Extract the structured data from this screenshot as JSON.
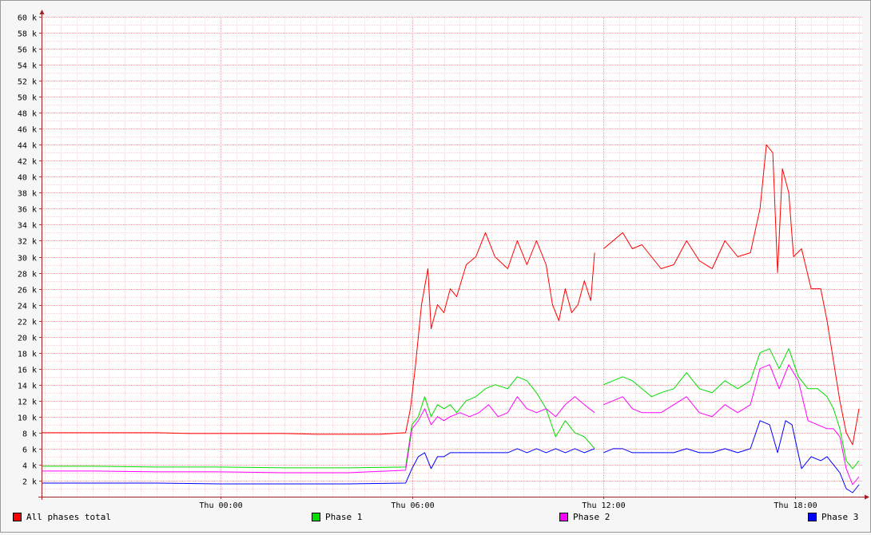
{
  "chart_data": {
    "type": "line",
    "ylim": [
      0,
      60000
    ],
    "y_ticks": [
      {
        "value": 2000,
        "label": "2 k"
      },
      {
        "value": 4000,
        "label": "4 k"
      },
      {
        "value": 6000,
        "label": "6 k"
      },
      {
        "value": 8000,
        "label": "8 k"
      },
      {
        "value": 10000,
        "label": "10 k"
      },
      {
        "value": 12000,
        "label": "12 k"
      },
      {
        "value": 14000,
        "label": "14 k"
      },
      {
        "value": 16000,
        "label": "16 k"
      },
      {
        "value": 18000,
        "label": "18 k"
      },
      {
        "value": 20000,
        "label": "20 k"
      },
      {
        "value": 22000,
        "label": "22 k"
      },
      {
        "value": 24000,
        "label": "24 k"
      },
      {
        "value": 26000,
        "label": "26 k"
      },
      {
        "value": 28000,
        "label": "28 k"
      },
      {
        "value": 30000,
        "label": "30 k"
      },
      {
        "value": 32000,
        "label": "32 k"
      },
      {
        "value": 34000,
        "label": "34 k"
      },
      {
        "value": 36000,
        "label": "36 k"
      },
      {
        "value": 38000,
        "label": "38 k"
      },
      {
        "value": 40000,
        "label": "40 k"
      },
      {
        "value": 42000,
        "label": "42 k"
      },
      {
        "value": 44000,
        "label": "44 k"
      },
      {
        "value": 46000,
        "label": "46 k"
      },
      {
        "value": 48000,
        "label": "48 k"
      },
      {
        "value": 50000,
        "label": "50 k"
      },
      {
        "value": 52000,
        "label": "52 k"
      },
      {
        "value": 54000,
        "label": "54 k"
      },
      {
        "value": 56000,
        "label": "56 k"
      },
      {
        "value": 58000,
        "label": "58 k"
      },
      {
        "value": 60000,
        "label": "60 k"
      }
    ],
    "xlim": [
      -5.6,
      20.1
    ],
    "x_unit": "hours relative to Thu 00:00",
    "x_ticks": [
      {
        "value": 0,
        "label": "Thu 00:00"
      },
      {
        "value": 6,
        "label": "Thu 06:00"
      },
      {
        "value": 12,
        "label": "Thu 12:00"
      },
      {
        "value": 18,
        "label": "Thu 18:00"
      }
    ],
    "grid": true,
    "legend_position": "bottom",
    "series": [
      {
        "name": "All phases total",
        "color": "#ff0000",
        "points": [
          [
            -5.6,
            8000
          ],
          [
            -5.0,
            8000
          ],
          [
            -4.0,
            8000
          ],
          [
            -3.0,
            8000
          ],
          [
            -2.0,
            8000
          ],
          [
            -1.0,
            7900
          ],
          [
            0.0,
            7900
          ],
          [
            1.0,
            7900
          ],
          [
            2.0,
            7900
          ],
          [
            3.0,
            7800
          ],
          [
            4.0,
            7800
          ],
          [
            5.0,
            7800
          ],
          [
            5.8,
            8000
          ],
          [
            5.95,
            11000
          ],
          [
            6.1,
            16000
          ],
          [
            6.3,
            24000
          ],
          [
            6.5,
            28500
          ],
          [
            6.6,
            21000
          ],
          [
            6.8,
            24000
          ],
          [
            7.0,
            23000
          ],
          [
            7.2,
            26000
          ],
          [
            7.4,
            25000
          ],
          [
            7.7,
            29000
          ],
          [
            8.0,
            30000
          ],
          [
            8.3,
            33000
          ],
          [
            8.6,
            30000
          ],
          [
            9.0,
            28500
          ],
          [
            9.3,
            32000
          ],
          [
            9.6,
            29000
          ],
          [
            9.9,
            32000
          ],
          [
            10.2,
            29000
          ],
          [
            10.4,
            24000
          ],
          [
            10.6,
            22000
          ],
          [
            10.8,
            26000
          ],
          [
            11.0,
            23000
          ],
          [
            11.2,
            24000
          ],
          [
            11.4,
            27000
          ],
          [
            11.6,
            24500
          ],
          [
            11.72,
            30500
          ],
          [
            11.73,
            null
          ],
          [
            12.0,
            31000
          ],
          [
            12.3,
            32000
          ],
          [
            12.6,
            33000
          ],
          [
            12.9,
            31000
          ],
          [
            13.2,
            31500
          ],
          [
            13.5,
            30000
          ],
          [
            13.8,
            28500
          ],
          [
            14.2,
            29000
          ],
          [
            14.6,
            32000
          ],
          [
            15.0,
            29500
          ],
          [
            15.4,
            28500
          ],
          [
            15.8,
            32000
          ],
          [
            16.2,
            30000
          ],
          [
            16.6,
            30500
          ],
          [
            16.9,
            36000
          ],
          [
            17.1,
            44000
          ],
          [
            17.3,
            43000
          ],
          [
            17.45,
            28000
          ],
          [
            17.6,
            41000
          ],
          [
            17.8,
            38000
          ],
          [
            17.95,
            30000
          ],
          [
            18.2,
            31000
          ],
          [
            18.5,
            26000
          ],
          [
            18.8,
            26000
          ],
          [
            19.0,
            22000
          ],
          [
            19.2,
            17000
          ],
          [
            19.4,
            12000
          ],
          [
            19.6,
            8000
          ],
          [
            19.8,
            6500
          ],
          [
            20.0,
            11000
          ]
        ]
      },
      {
        "name": "Phase 1",
        "color": "#00dd00",
        "points": [
          [
            -5.6,
            3800
          ],
          [
            -4.0,
            3800
          ],
          [
            -2.0,
            3700
          ],
          [
            0.0,
            3700
          ],
          [
            2.0,
            3600
          ],
          [
            4.0,
            3600
          ],
          [
            5.8,
            3700
          ],
          [
            6.0,
            9000
          ],
          [
            6.2,
            10000
          ],
          [
            6.4,
            12500
          ],
          [
            6.6,
            10000
          ],
          [
            6.8,
            11500
          ],
          [
            7.0,
            11000
          ],
          [
            7.2,
            11500
          ],
          [
            7.4,
            10500
          ],
          [
            7.7,
            12000
          ],
          [
            8.0,
            12500
          ],
          [
            8.3,
            13500
          ],
          [
            8.6,
            14000
          ],
          [
            9.0,
            13500
          ],
          [
            9.3,
            15000
          ],
          [
            9.6,
            14500
          ],
          [
            9.9,
            13000
          ],
          [
            10.2,
            11000
          ],
          [
            10.5,
            7500
          ],
          [
            10.8,
            9500
          ],
          [
            11.1,
            8000
          ],
          [
            11.4,
            7500
          ],
          [
            11.72,
            6000
          ],
          [
            11.73,
            null
          ],
          [
            12.0,
            14000
          ],
          [
            12.3,
            14500
          ],
          [
            12.6,
            15000
          ],
          [
            12.9,
            14500
          ],
          [
            13.2,
            13500
          ],
          [
            13.5,
            12500
          ],
          [
            13.8,
            13000
          ],
          [
            14.2,
            13500
          ],
          [
            14.6,
            15500
          ],
          [
            15.0,
            13500
          ],
          [
            15.4,
            13000
          ],
          [
            15.8,
            14500
          ],
          [
            16.2,
            13500
          ],
          [
            16.6,
            14500
          ],
          [
            16.9,
            18000
          ],
          [
            17.2,
            18500
          ],
          [
            17.5,
            16000
          ],
          [
            17.8,
            18500
          ],
          [
            18.1,
            15000
          ],
          [
            18.4,
            13500
          ],
          [
            18.7,
            13500
          ],
          [
            19.0,
            12500
          ],
          [
            19.2,
            11000
          ],
          [
            19.4,
            8500
          ],
          [
            19.6,
            4500
          ],
          [
            19.8,
            3500
          ],
          [
            20.0,
            4500
          ]
        ]
      },
      {
        "name": "Phase 2",
        "color": "#ff00ff",
        "points": [
          [
            -5.6,
            3200
          ],
          [
            -4.0,
            3200
          ],
          [
            -2.0,
            3100
          ],
          [
            0.0,
            3100
          ],
          [
            2.0,
            3000
          ],
          [
            4.0,
            3000
          ],
          [
            5.8,
            3300
          ],
          [
            6.0,
            8500
          ],
          [
            6.2,
            9500
          ],
          [
            6.4,
            11000
          ],
          [
            6.6,
            9000
          ],
          [
            6.8,
            10000
          ],
          [
            7.0,
            9500
          ],
          [
            7.2,
            10000
          ],
          [
            7.5,
            10500
          ],
          [
            7.8,
            10000
          ],
          [
            8.1,
            10500
          ],
          [
            8.4,
            11500
          ],
          [
            8.7,
            10000
          ],
          [
            9.0,
            10500
          ],
          [
            9.3,
            12500
          ],
          [
            9.6,
            11000
          ],
          [
            9.9,
            10500
          ],
          [
            10.2,
            11000
          ],
          [
            10.5,
            10000
          ],
          [
            10.8,
            11500
          ],
          [
            11.1,
            12500
          ],
          [
            11.4,
            11500
          ],
          [
            11.72,
            10500
          ],
          [
            11.73,
            null
          ],
          [
            12.0,
            11500
          ],
          [
            12.3,
            12000
          ],
          [
            12.6,
            12500
          ],
          [
            12.9,
            11000
          ],
          [
            13.2,
            10500
          ],
          [
            13.5,
            10500
          ],
          [
            13.8,
            10500
          ],
          [
            14.2,
            11500
          ],
          [
            14.6,
            12500
          ],
          [
            15.0,
            10500
          ],
          [
            15.4,
            10000
          ],
          [
            15.8,
            11500
          ],
          [
            16.2,
            10500
          ],
          [
            16.6,
            11500
          ],
          [
            16.9,
            16000
          ],
          [
            17.2,
            16500
          ],
          [
            17.5,
            13500
          ],
          [
            17.8,
            16500
          ],
          [
            18.1,
            14500
          ],
          [
            18.4,
            9500
          ],
          [
            18.7,
            9000
          ],
          [
            19.0,
            8500
          ],
          [
            19.2,
            8500
          ],
          [
            19.4,
            7500
          ],
          [
            19.6,
            3500
          ],
          [
            19.8,
            1500
          ],
          [
            20.0,
            2500
          ]
        ]
      },
      {
        "name": "Phase 3",
        "color": "#0000ff",
        "points": [
          [
            -5.6,
            1700
          ],
          [
            -4.0,
            1700
          ],
          [
            -2.0,
            1700
          ],
          [
            0.0,
            1600
          ],
          [
            2.0,
            1600
          ],
          [
            4.0,
            1600
          ],
          [
            5.8,
            1700
          ],
          [
            6.0,
            3500
          ],
          [
            6.2,
            5000
          ],
          [
            6.4,
            5500
          ],
          [
            6.6,
            3500
          ],
          [
            6.8,
            5000
          ],
          [
            7.0,
            5000
          ],
          [
            7.2,
            5500
          ],
          [
            7.5,
            5500
          ],
          [
            7.8,
            5500
          ],
          [
            8.1,
            5500
          ],
          [
            8.4,
            5500
          ],
          [
            8.7,
            5500
          ],
          [
            9.0,
            5500
          ],
          [
            9.3,
            6000
          ],
          [
            9.6,
            5500
          ],
          [
            9.9,
            6000
          ],
          [
            10.2,
            5500
          ],
          [
            10.5,
            6000
          ],
          [
            10.8,
            5500
          ],
          [
            11.1,
            6000
          ],
          [
            11.4,
            5500
          ],
          [
            11.72,
            6000
          ],
          [
            11.73,
            null
          ],
          [
            12.0,
            5500
          ],
          [
            12.3,
            6000
          ],
          [
            12.6,
            6000
          ],
          [
            12.9,
            5500
          ],
          [
            13.2,
            5500
          ],
          [
            13.5,
            5500
          ],
          [
            13.8,
            5500
          ],
          [
            14.2,
            5500
          ],
          [
            14.6,
            6000
          ],
          [
            15.0,
            5500
          ],
          [
            15.4,
            5500
          ],
          [
            15.8,
            6000
          ],
          [
            16.2,
            5500
          ],
          [
            16.6,
            6000
          ],
          [
            16.9,
            9500
          ],
          [
            17.2,
            9000
          ],
          [
            17.45,
            5500
          ],
          [
            17.7,
            9500
          ],
          [
            17.9,
            9000
          ],
          [
            18.2,
            3500
          ],
          [
            18.5,
            5000
          ],
          [
            18.8,
            4500
          ],
          [
            19.0,
            5000
          ],
          [
            19.2,
            4000
          ],
          [
            19.4,
            3000
          ],
          [
            19.6,
            1000
          ],
          [
            19.8,
            500
          ],
          [
            20.0,
            1500
          ]
        ]
      }
    ]
  }
}
